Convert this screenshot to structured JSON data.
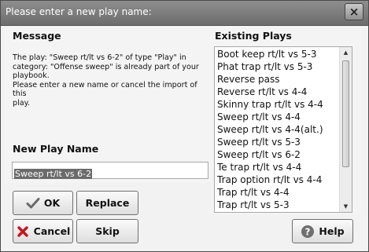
{
  "window": {
    "title": "Please enter a new play name:",
    "close_glyph": "×"
  },
  "message": {
    "heading": "Message",
    "lines": [
      "The play: \"Sweep rt/lt vs 6-2\" of type \"Play\" in",
      "category: \"Offense sweep\" is already part of your",
      "playbook.",
      "Please enter a new name or cancel the import of this",
      "play."
    ]
  },
  "new_play": {
    "heading": "New Play Name",
    "value": "Sweep rt/lt vs 6-2"
  },
  "existing": {
    "heading": "Existing Plays",
    "items": [
      "Boot keep rt/lt vs 5-3",
      "Phat trap rt/lt vs 5-3",
      "Reverse pass",
      "Reverse rt/lt vs 4-4",
      "Skinny trap rt/lt vs 4-4",
      "Sweep rt/lt  vs 4-4",
      "Sweep rt/lt vs 4-4(alt.)",
      "Sweep rt/lt vs 5-3",
      "Sweep rt/lt vs 6-2",
      "Te trap rt/lt vs 4-4",
      "Trap option rt/lt vs 4-4",
      "Trap rt/lt vs 4-4",
      "Trap rt/lt vs 5-3"
    ]
  },
  "buttons": {
    "ok": "OK",
    "replace": "Replace",
    "cancel": "Cancel",
    "skip": "Skip",
    "help": "Help"
  },
  "colors": {
    "titlebar": "#7a7a7a",
    "selection": "#6b6b6b",
    "cancel_icon": "#c8141e",
    "help_icon": "#6e6e6e"
  }
}
